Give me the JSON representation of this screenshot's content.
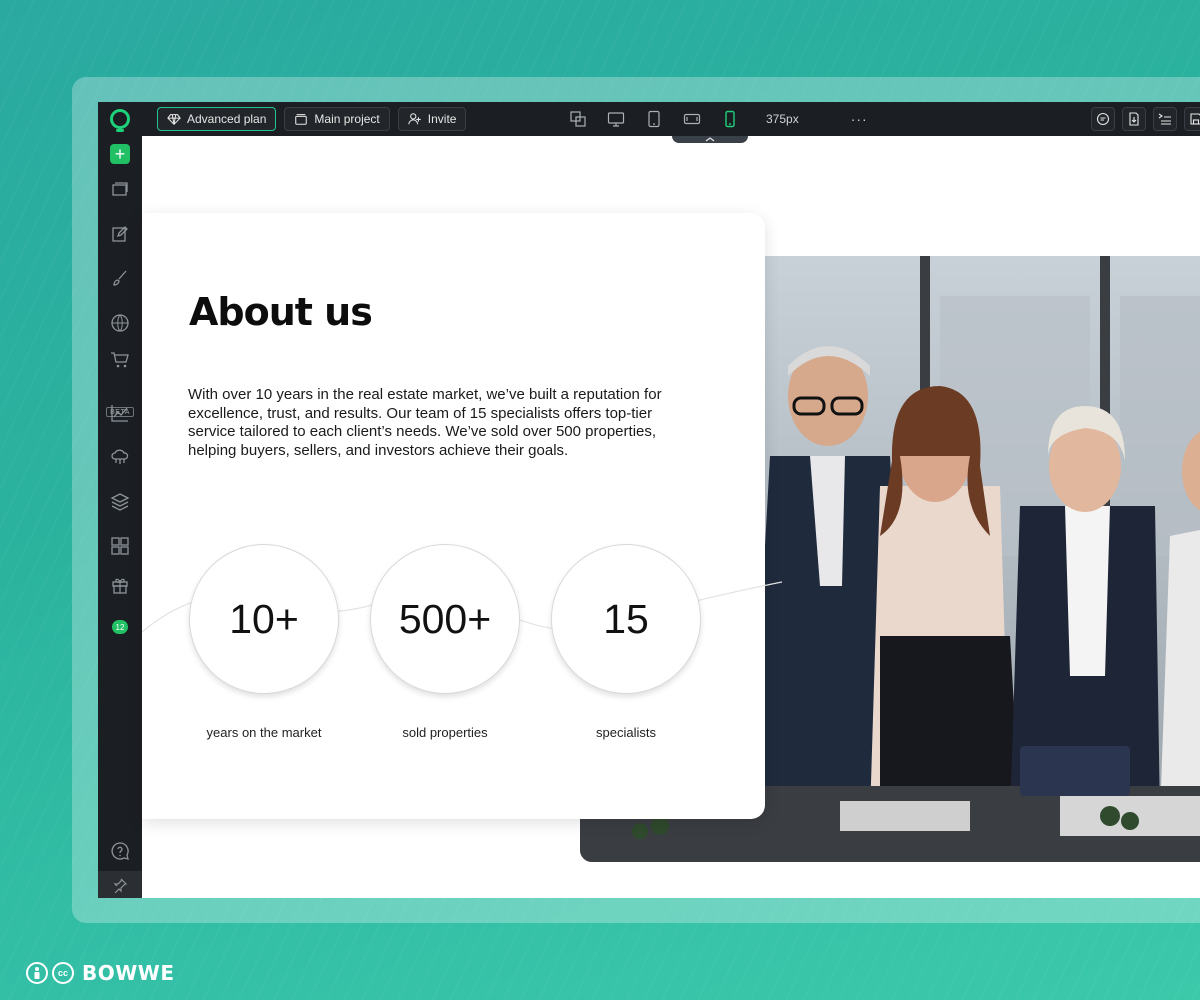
{
  "topbar": {
    "plan_label": "Advanced plan",
    "project_label": "Main project",
    "invite_label": "Invite",
    "width_label": "375px",
    "more_label": "···"
  },
  "sidebar": {
    "beta_label": "BETA",
    "gifts_badge": "12"
  },
  "content": {
    "title": "About us",
    "paragraph": "With over 10 years in the real estate market, we’ve built a reputation for excellence, trust, and results. Our team of 15 specialists offers top-tier service tailored to each client’s needs. We’ve sold over 500 properties, helping buyers, sellers, and investors achieve their goals.",
    "stats": [
      {
        "value": "10+",
        "label": "years on the market"
      },
      {
        "value": "500+",
        "label": "sold properties"
      },
      {
        "value": "15",
        "label": "specialists"
      }
    ]
  },
  "footer": {
    "brand": "BOWWE"
  },
  "colors": {
    "accent_green": "#22c065",
    "bar_dark": "#1b1e22",
    "active_device": "#1fd07a"
  }
}
